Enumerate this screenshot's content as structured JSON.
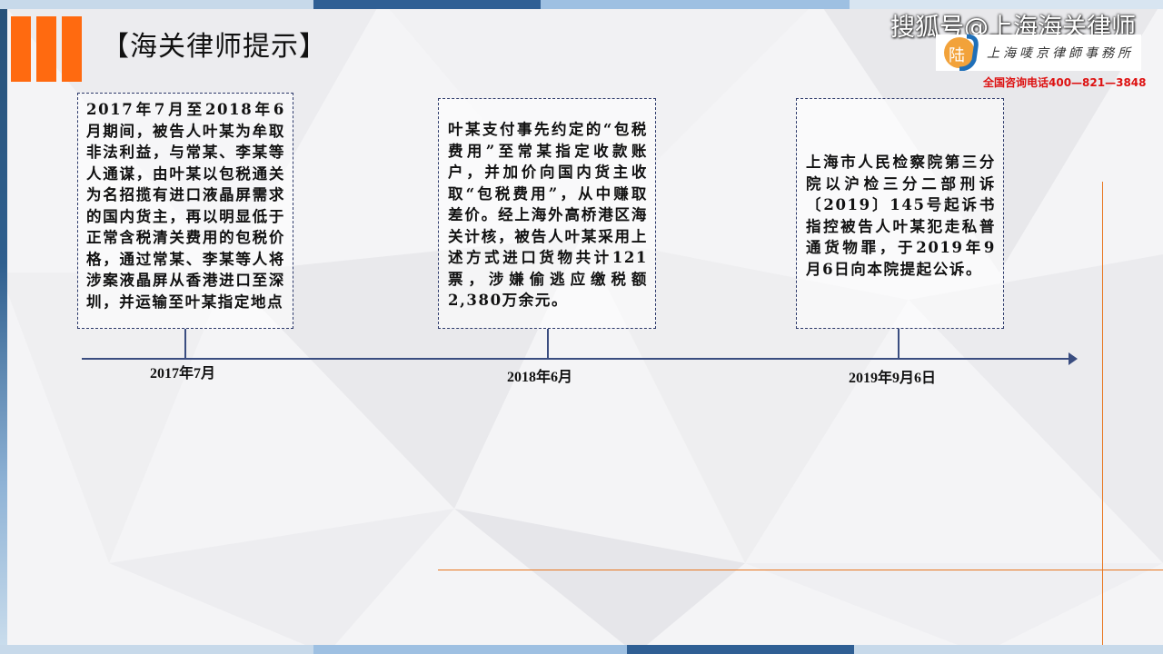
{
  "header": {
    "title": "【海关律师提示】"
  },
  "watermark": {
    "text": "搜狐号@上海海关律师"
  },
  "logo": {
    "mark_char": "陆",
    "firm_name": "上海唛京律師事務所",
    "hotline": "全国咨询电话400—821—3848"
  },
  "events": [
    {
      "text": "2017年7月至2018年6月期间，被告人叶某为牟取非法利益，与常某、李某等人通谋，由叶某以包税通关为名招揽有进口液晶屏需求的国内货主，再以明显低于正常含税清关费用的包税价格，通过常某、李某等人将涉案液晶屏从香港进口至深圳，并运输至叶某指定地点",
      "date": "2017年7月"
    },
    {
      "text": "叶某支付事先约定的“包税费用”至常某指定收款账户，并加价向国内货主收取“包税费用”，从中赚取差价。经上海外高桥港区海关计核，被告人叶某采用上述方式进口货物共计121票，涉嫌偷逃应缴税额2,380万余元。",
      "date": "2018年6月"
    },
    {
      "text": "上海市人民检察院第三分院以沪检三分二部刑诉〔2019〕145号起诉书指控被告人叶某犯走私普通货物罪，于2019年9月6日向本院提起公诉。",
      "date": "2019年9月6日"
    }
  ],
  "colors": {
    "accent_orange": "#ff6a10",
    "timeline_navy": "#3a4d80",
    "hotline_red": "#dd1111",
    "band_dark_blue": "#2f5f94",
    "band_light_blue": "#9ec0e2"
  }
}
